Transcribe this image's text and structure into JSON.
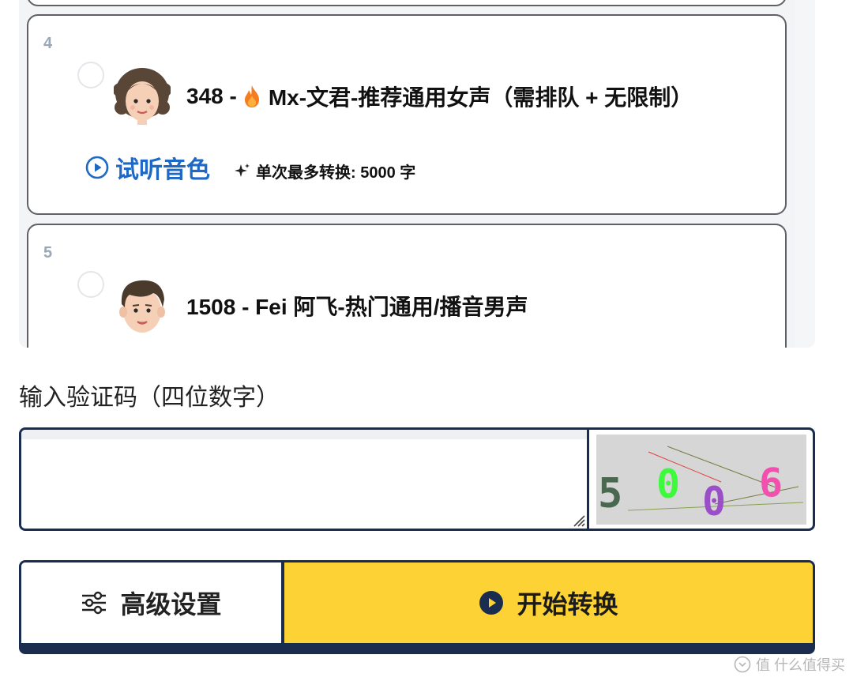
{
  "voices": [
    {
      "index": "4",
      "name_prefix": "348 - ",
      "name_main": "Mx-文君-推荐通用女声（需排队 + 无限制）",
      "hot_icon": "fire-icon",
      "listen_label": "试听音色",
      "max_chars": "单次最多转换: 5000 字"
    },
    {
      "index": "5",
      "name": "1508 - Fei 阿飞-热门通用/播音男声"
    }
  ],
  "captcha": {
    "label": "输入验证码（四位数字）",
    "value": "",
    "image_text": "5 0 0 6"
  },
  "buttons": {
    "advanced": "高级设置",
    "start": "开始转换"
  },
  "colors": {
    "accent_blue": "#1e68c6",
    "start_yellow": "#fdd235",
    "frame_navy": "#1b2d4f"
  },
  "watermark": "值 什么值得买"
}
